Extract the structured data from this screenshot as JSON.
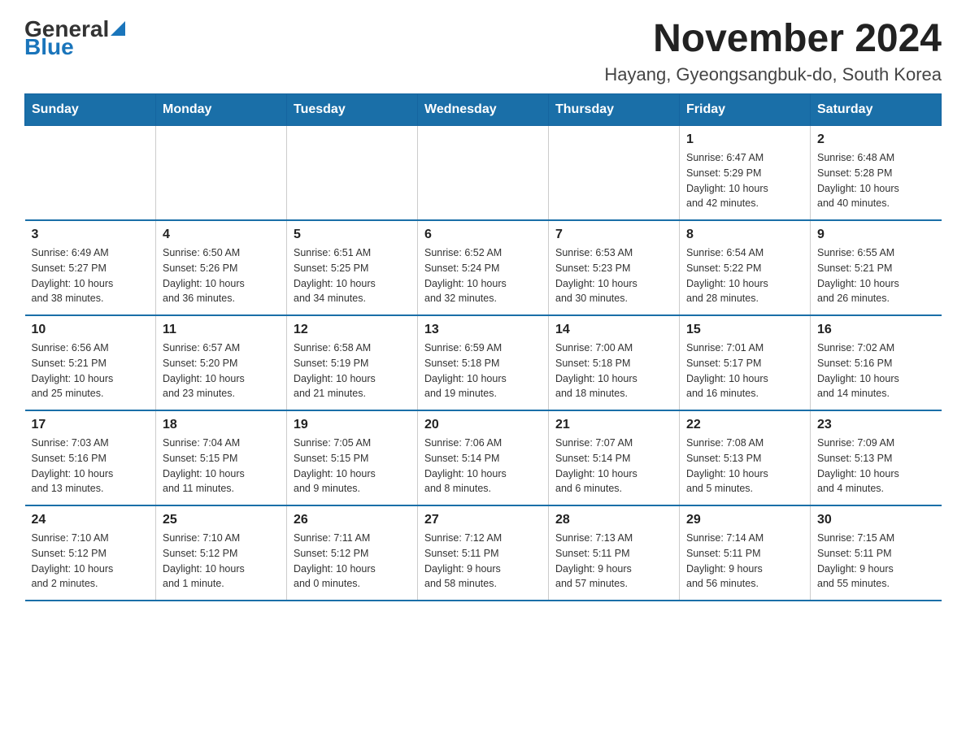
{
  "header": {
    "logo_general": "General",
    "logo_blue": "Blue",
    "title": "November 2024",
    "subtitle": "Hayang, Gyeongsangbuk-do, South Korea"
  },
  "weekdays": [
    "Sunday",
    "Monday",
    "Tuesday",
    "Wednesday",
    "Thursday",
    "Friday",
    "Saturday"
  ],
  "weeks": [
    [
      {
        "day": "",
        "info": ""
      },
      {
        "day": "",
        "info": ""
      },
      {
        "day": "",
        "info": ""
      },
      {
        "day": "",
        "info": ""
      },
      {
        "day": "",
        "info": ""
      },
      {
        "day": "1",
        "info": "Sunrise: 6:47 AM\nSunset: 5:29 PM\nDaylight: 10 hours\nand 42 minutes."
      },
      {
        "day": "2",
        "info": "Sunrise: 6:48 AM\nSunset: 5:28 PM\nDaylight: 10 hours\nand 40 minutes."
      }
    ],
    [
      {
        "day": "3",
        "info": "Sunrise: 6:49 AM\nSunset: 5:27 PM\nDaylight: 10 hours\nand 38 minutes."
      },
      {
        "day": "4",
        "info": "Sunrise: 6:50 AM\nSunset: 5:26 PM\nDaylight: 10 hours\nand 36 minutes."
      },
      {
        "day": "5",
        "info": "Sunrise: 6:51 AM\nSunset: 5:25 PM\nDaylight: 10 hours\nand 34 minutes."
      },
      {
        "day": "6",
        "info": "Sunrise: 6:52 AM\nSunset: 5:24 PM\nDaylight: 10 hours\nand 32 minutes."
      },
      {
        "day": "7",
        "info": "Sunrise: 6:53 AM\nSunset: 5:23 PM\nDaylight: 10 hours\nand 30 minutes."
      },
      {
        "day": "8",
        "info": "Sunrise: 6:54 AM\nSunset: 5:22 PM\nDaylight: 10 hours\nand 28 minutes."
      },
      {
        "day": "9",
        "info": "Sunrise: 6:55 AM\nSunset: 5:21 PM\nDaylight: 10 hours\nand 26 minutes."
      }
    ],
    [
      {
        "day": "10",
        "info": "Sunrise: 6:56 AM\nSunset: 5:21 PM\nDaylight: 10 hours\nand 25 minutes."
      },
      {
        "day": "11",
        "info": "Sunrise: 6:57 AM\nSunset: 5:20 PM\nDaylight: 10 hours\nand 23 minutes."
      },
      {
        "day": "12",
        "info": "Sunrise: 6:58 AM\nSunset: 5:19 PM\nDaylight: 10 hours\nand 21 minutes."
      },
      {
        "day": "13",
        "info": "Sunrise: 6:59 AM\nSunset: 5:18 PM\nDaylight: 10 hours\nand 19 minutes."
      },
      {
        "day": "14",
        "info": "Sunrise: 7:00 AM\nSunset: 5:18 PM\nDaylight: 10 hours\nand 18 minutes."
      },
      {
        "day": "15",
        "info": "Sunrise: 7:01 AM\nSunset: 5:17 PM\nDaylight: 10 hours\nand 16 minutes."
      },
      {
        "day": "16",
        "info": "Sunrise: 7:02 AM\nSunset: 5:16 PM\nDaylight: 10 hours\nand 14 minutes."
      }
    ],
    [
      {
        "day": "17",
        "info": "Sunrise: 7:03 AM\nSunset: 5:16 PM\nDaylight: 10 hours\nand 13 minutes."
      },
      {
        "day": "18",
        "info": "Sunrise: 7:04 AM\nSunset: 5:15 PM\nDaylight: 10 hours\nand 11 minutes."
      },
      {
        "day": "19",
        "info": "Sunrise: 7:05 AM\nSunset: 5:15 PM\nDaylight: 10 hours\nand 9 minutes."
      },
      {
        "day": "20",
        "info": "Sunrise: 7:06 AM\nSunset: 5:14 PM\nDaylight: 10 hours\nand 8 minutes."
      },
      {
        "day": "21",
        "info": "Sunrise: 7:07 AM\nSunset: 5:14 PM\nDaylight: 10 hours\nand 6 minutes."
      },
      {
        "day": "22",
        "info": "Sunrise: 7:08 AM\nSunset: 5:13 PM\nDaylight: 10 hours\nand 5 minutes."
      },
      {
        "day": "23",
        "info": "Sunrise: 7:09 AM\nSunset: 5:13 PM\nDaylight: 10 hours\nand 4 minutes."
      }
    ],
    [
      {
        "day": "24",
        "info": "Sunrise: 7:10 AM\nSunset: 5:12 PM\nDaylight: 10 hours\nand 2 minutes."
      },
      {
        "day": "25",
        "info": "Sunrise: 7:10 AM\nSunset: 5:12 PM\nDaylight: 10 hours\nand 1 minute."
      },
      {
        "day": "26",
        "info": "Sunrise: 7:11 AM\nSunset: 5:12 PM\nDaylight: 10 hours\nand 0 minutes."
      },
      {
        "day": "27",
        "info": "Sunrise: 7:12 AM\nSunset: 5:11 PM\nDaylight: 9 hours\nand 58 minutes."
      },
      {
        "day": "28",
        "info": "Sunrise: 7:13 AM\nSunset: 5:11 PM\nDaylight: 9 hours\nand 57 minutes."
      },
      {
        "day": "29",
        "info": "Sunrise: 7:14 AM\nSunset: 5:11 PM\nDaylight: 9 hours\nand 56 minutes."
      },
      {
        "day": "30",
        "info": "Sunrise: 7:15 AM\nSunset: 5:11 PM\nDaylight: 9 hours\nand 55 minutes."
      }
    ]
  ]
}
